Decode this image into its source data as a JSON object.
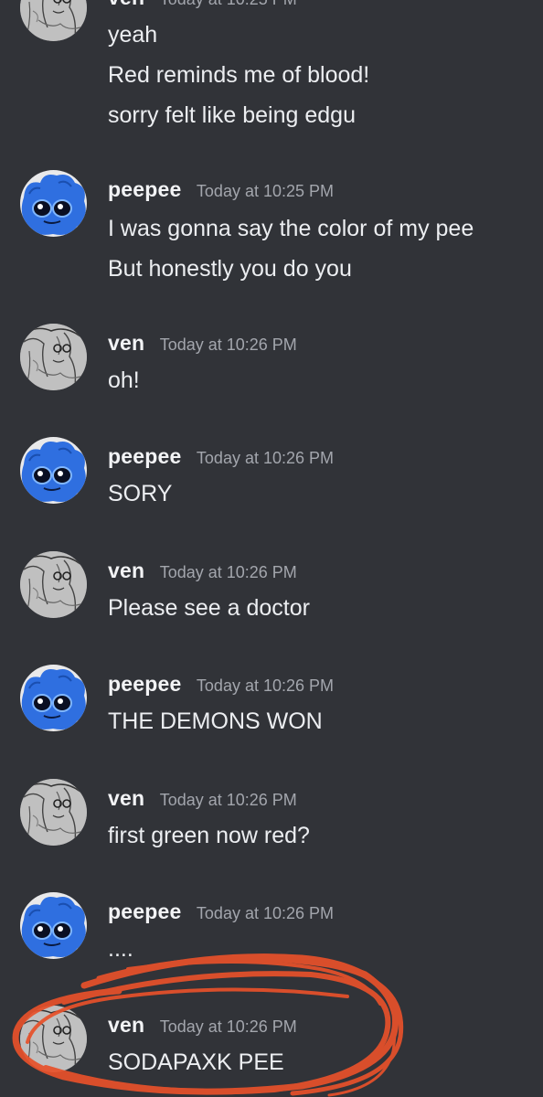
{
  "colors": {
    "background": "#313338",
    "username": "#f2f3f5",
    "timestamp": "#a3a6ad",
    "message_text": "#eceef1",
    "scribble": "#e8512a",
    "avatar_peepee": "#2f6fe0"
  },
  "messages": [
    {
      "author": "ven",
      "timestamp": "Today at 10:25 PM",
      "avatar_icon": "ven-sketch-avatar-icon",
      "lines": [
        "yeah",
        "Red reminds me of blood!",
        "sorry felt like being edgu"
      ]
    },
    {
      "author": "peepee",
      "timestamp": "Today at 10:25 PM",
      "avatar_icon": "peepee-blue-avatar-icon",
      "lines": [
        "I was gonna say the color of my pee",
        "But honestly you do you"
      ]
    },
    {
      "author": "ven",
      "timestamp": "Today at 10:26 PM",
      "avatar_icon": "ven-sketch-avatar-icon",
      "lines": [
        "oh!"
      ]
    },
    {
      "author": "peepee",
      "timestamp": "Today at 10:26 PM",
      "avatar_icon": "peepee-blue-avatar-icon",
      "lines": [
        "SORY"
      ]
    },
    {
      "author": "ven",
      "timestamp": "Today at 10:26 PM",
      "avatar_icon": "ven-sketch-avatar-icon",
      "lines": [
        "Please see a doctor"
      ]
    },
    {
      "author": "peepee",
      "timestamp": "Today at 10:26 PM",
      "avatar_icon": "peepee-blue-avatar-icon",
      "lines": [
        "THE DEMONS WON"
      ]
    },
    {
      "author": "ven",
      "timestamp": "Today at 10:26 PM",
      "avatar_icon": "ven-sketch-avatar-icon",
      "lines": [
        "first green now red?"
      ]
    },
    {
      "author": "peepee",
      "timestamp": "Today at 10:26 PM",
      "avatar_icon": "peepee-blue-avatar-icon",
      "lines": [
        "...."
      ]
    },
    {
      "author": "ven",
      "timestamp": "Today at 10:26 PM",
      "avatar_icon": "ven-sketch-avatar-icon",
      "lines": [
        "SODAPAXK PEE"
      ]
    }
  ]
}
